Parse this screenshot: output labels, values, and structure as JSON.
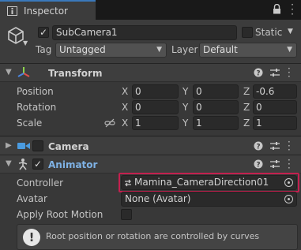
{
  "tab": {
    "title": "Inspector",
    "lock_icon": "lock-icon",
    "menu_icon": "kebab-menu-icon"
  },
  "object": {
    "active": true,
    "name": "SubCamera1",
    "static_label": "Static",
    "tag_label": "Tag",
    "tag_value": "Untagged",
    "layer_label": "Layer",
    "layer_value": "Default"
  },
  "transform": {
    "title": "Transform",
    "rows": [
      {
        "label": "Position",
        "x": "0",
        "y": "0",
        "z": "-0.6"
      },
      {
        "label": "Rotation",
        "x": "0",
        "y": "0",
        "z": "0"
      },
      {
        "label": "Scale",
        "x": "1",
        "y": "1",
        "z": "1"
      }
    ],
    "axis": {
      "x": "X",
      "y": "Y",
      "z": "Z"
    }
  },
  "camera": {
    "title": "Camera",
    "enabled": false
  },
  "animator": {
    "title": "Animator",
    "enabled": true,
    "controller_label": "Controller",
    "controller_value": "Mamina_CameraDirection01",
    "avatar_label": "Avatar",
    "avatar_value": "None (Avatar)",
    "root_motion_label": "Apply Root Motion",
    "root_motion": false,
    "help_text": "Root position or rotation are controlled by curves"
  },
  "colors": {
    "highlight": "#c4204f",
    "accent": "#3a79bb",
    "animator_title": "#7fb2e5"
  }
}
